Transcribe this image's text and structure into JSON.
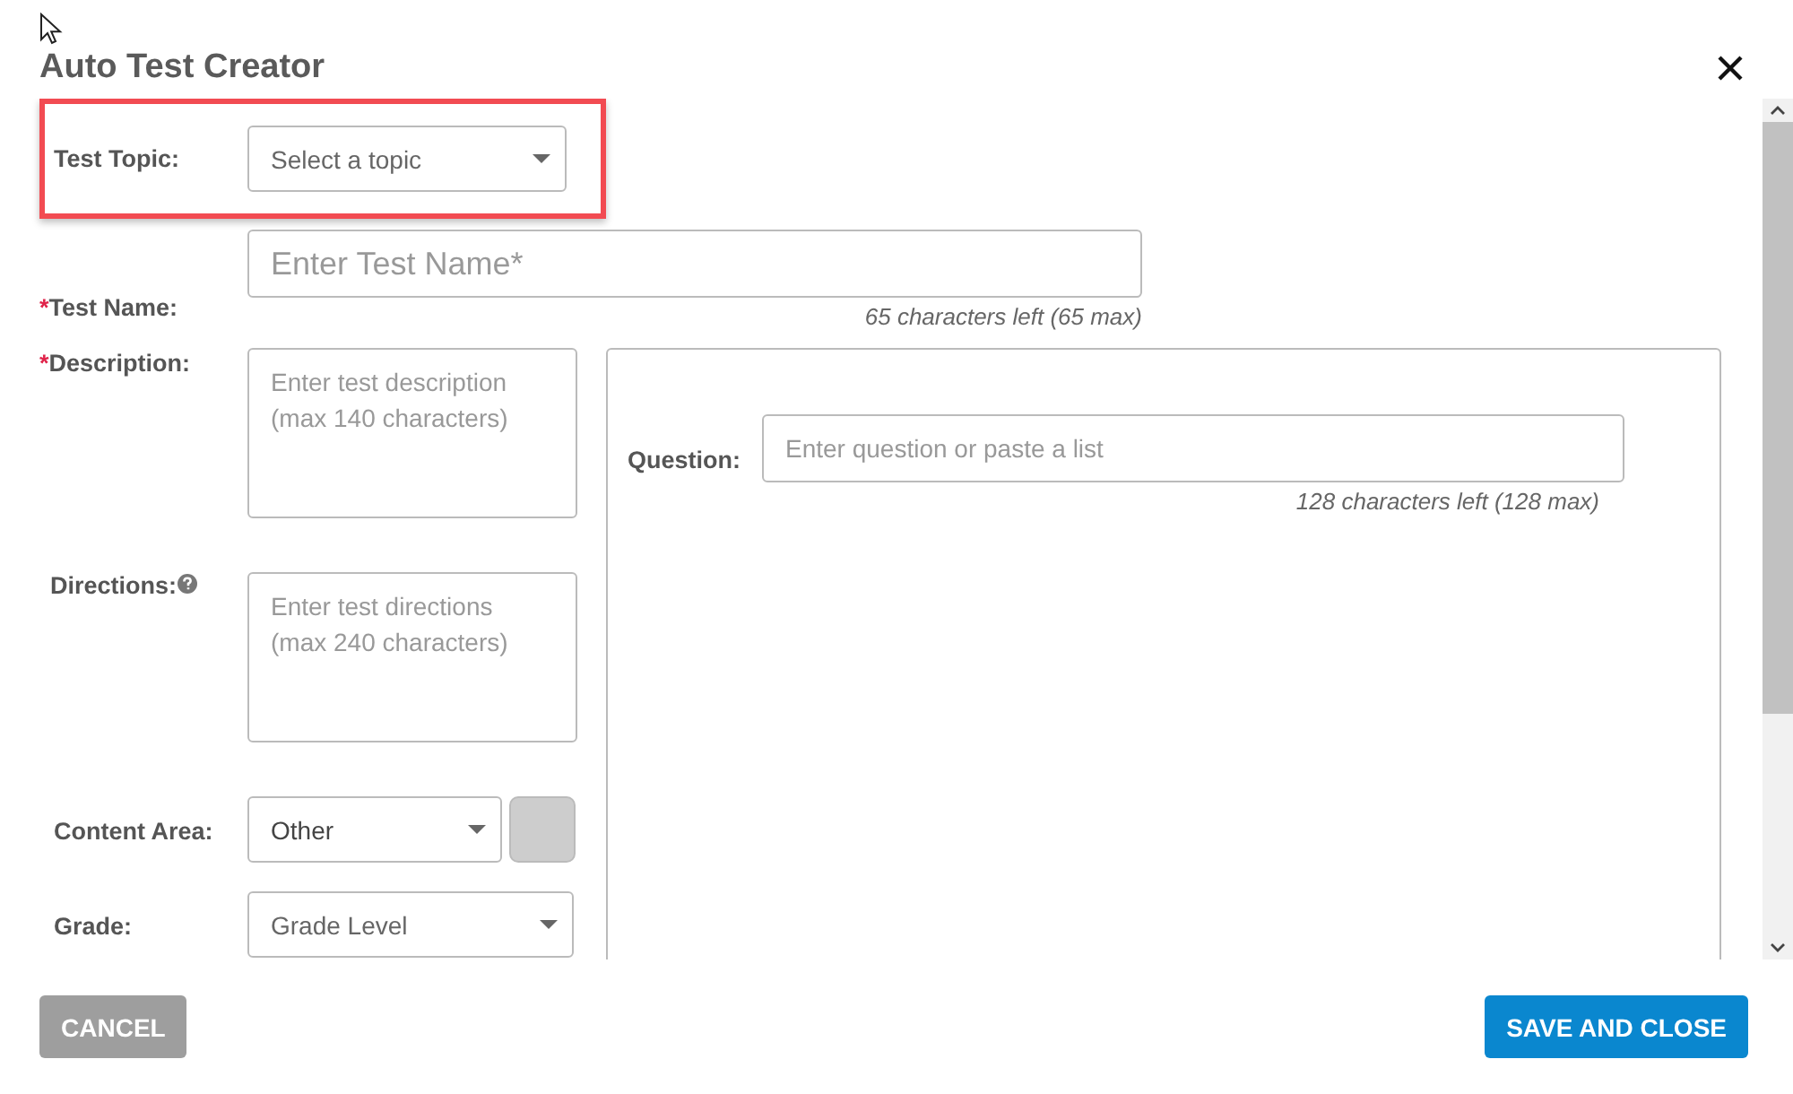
{
  "dialog": {
    "title": "Auto Test Creator"
  },
  "topic": {
    "label": "Test Topic:",
    "placeholder": "Select a topic",
    "highlighted": true
  },
  "test_name": {
    "label": "Test Name:",
    "required_mark": "*",
    "placeholder": "Enter Test Name*",
    "counter": "65 characters left (65 max)"
  },
  "description": {
    "label": "Description:",
    "required_mark": "*",
    "placeholder": "Enter test description\n(max 140 characters)"
  },
  "directions": {
    "label": "Directions:",
    "help": true,
    "placeholder": "Enter test directions\n(max 240 characters)"
  },
  "content_area": {
    "label": "Content Area:",
    "value": "Other"
  },
  "grade": {
    "label": "Grade:",
    "value": "Grade Level"
  },
  "question": {
    "label": "Question:",
    "placeholder": "Enter question or paste a list",
    "counter": "128 characters left (128 max)"
  },
  "buttons": [
    {
      "label": "CANCEL",
      "kind": "secondary"
    },
    {
      "label": "SAVE AND CLOSE",
      "kind": "primary"
    }
  ]
}
